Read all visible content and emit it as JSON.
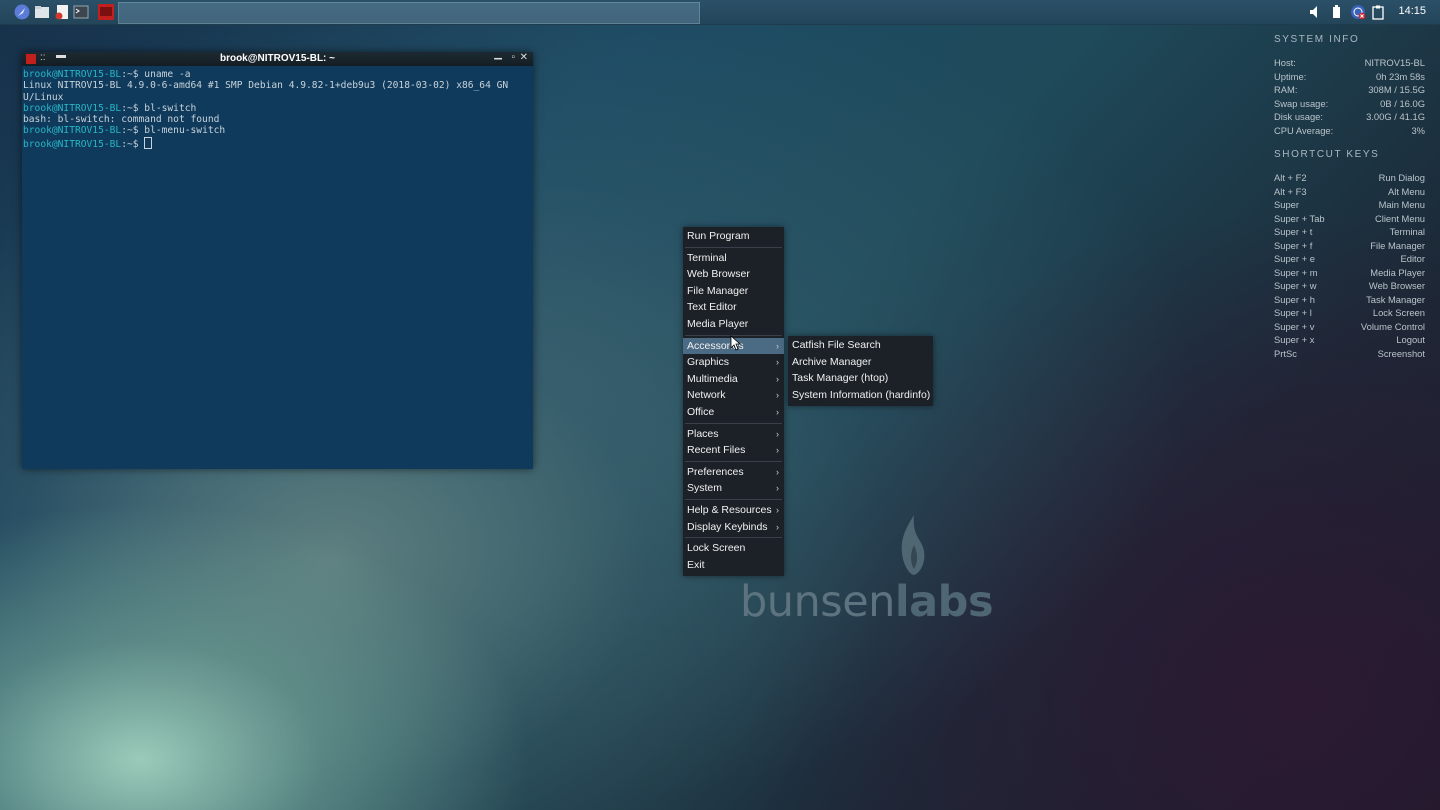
{
  "panel": {
    "clock": "14:15",
    "launchers": [
      "web-browser-icon",
      "file-manager-icon",
      "text-editor-icon",
      "terminal-icon"
    ],
    "task_icon": "terminal-window-icon"
  },
  "terminal": {
    "title": "brook@NITROV15-BL: ~",
    "title_left": "::",
    "lines": [
      {
        "prompt": "brook@NITROV15-BL",
        "rest": ":~$ uname -a"
      },
      {
        "prompt": "",
        "rest": "Linux NITROV15-BL 4.9.0-6-amd64 #1 SMP Debian 4.9.82-1+deb9u3 (2018-03-02) x86_64 GN"
      },
      {
        "prompt": "",
        "rest": "U/Linux"
      },
      {
        "prompt": "brook@NITROV15-BL",
        "rest": ":~$ bl-switch"
      },
      {
        "prompt": "",
        "rest": "bash: bl-switch: command not found"
      },
      {
        "prompt": "brook@NITROV15-BL",
        "rest": ":~$ bl-menu-switch"
      },
      {
        "prompt": "brook@NITROV15-BL",
        "rest": ":~$ "
      }
    ]
  },
  "menu": {
    "groups": [
      [
        {
          "label": "Run Program",
          "sub": false
        }
      ],
      [
        {
          "label": "Terminal",
          "sub": false
        },
        {
          "label": "Web Browser",
          "sub": false
        },
        {
          "label": "File Manager",
          "sub": false
        },
        {
          "label": "Text Editor",
          "sub": false
        },
        {
          "label": "Media Player",
          "sub": false
        }
      ],
      [
        {
          "label": "Accessories",
          "sub": true,
          "selected": true
        },
        {
          "label": "Graphics",
          "sub": true
        },
        {
          "label": "Multimedia",
          "sub": true
        },
        {
          "label": "Network",
          "sub": true
        },
        {
          "label": "Office",
          "sub": true
        }
      ],
      [
        {
          "label": "Places",
          "sub": true
        },
        {
          "label": "Recent Files",
          "sub": true
        }
      ],
      [
        {
          "label": "Preferences",
          "sub": true
        },
        {
          "label": "System",
          "sub": true
        }
      ],
      [
        {
          "label": "Help & Resources",
          "sub": true
        },
        {
          "label": "Display Keybinds",
          "sub": true
        }
      ],
      [
        {
          "label": "Lock Screen",
          "sub": false
        },
        {
          "label": "Exit",
          "sub": false
        }
      ]
    ]
  },
  "submenu": {
    "items": [
      "Catfish File Search",
      "Archive Manager",
      "Task Manager (htop)",
      "System Information (hardinfo)"
    ]
  },
  "conky": {
    "system_header": "SYSTEM INFO",
    "system": [
      {
        "k": "Host:",
        "v": "NITROV15-BL"
      },
      {
        "k": "Uptime:",
        "v": "0h 23m 58s"
      },
      {
        "k": "RAM:",
        "v": "308M / 15.5G"
      },
      {
        "k": "Swap usage:",
        "v": "0B / 16.0G"
      },
      {
        "k": "Disk usage:",
        "v": "3.00G / 41.1G"
      },
      {
        "k": "CPU Average:",
        "v": "3%"
      }
    ],
    "keys_header": "SHORTCUT KEYS",
    "keys": [
      {
        "k": "Alt + F2",
        "v": "Run Dialog"
      },
      {
        "k": "Alt + F3",
        "v": "Alt Menu"
      },
      {
        "k": "Super",
        "v": "Main Menu"
      },
      {
        "k": "Super + Tab",
        "v": "Client Menu"
      },
      {
        "k": "Super + t",
        "v": "Terminal"
      },
      {
        "k": "Super + f",
        "v": "File Manager"
      },
      {
        "k": "Super + e",
        "v": "Editor"
      },
      {
        "k": "Super + m",
        "v": "Media Player"
      },
      {
        "k": "Super + w",
        "v": "Web Browser"
      },
      {
        "k": "Super + h",
        "v": "Task Manager"
      },
      {
        "k": "Super + l",
        "v": "Lock Screen"
      },
      {
        "k": "Super + v",
        "v": "Volume Control"
      },
      {
        "k": "Super + x",
        "v": "Logout"
      },
      {
        "k": "PrtSc",
        "v": "Screenshot"
      }
    ]
  },
  "logo": {
    "light": "bunsen",
    "bold": "labs"
  },
  "colors": {
    "prompt": "#28b6c6",
    "menu_bg": "#1c2128",
    "menu_sel": "#4b6a84",
    "terminal_bg": "#0f3a5c"
  }
}
